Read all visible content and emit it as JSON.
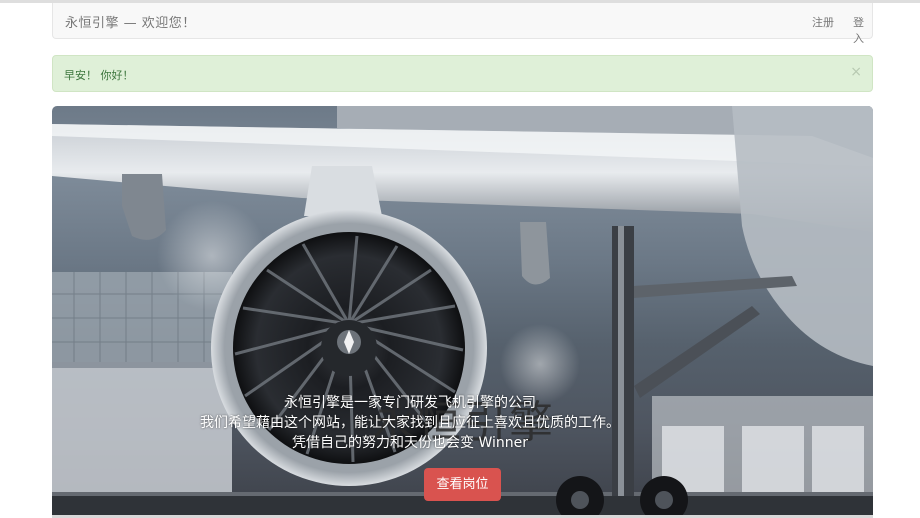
{
  "navbar": {
    "brand": "永恒引擎 — 欢迎您！",
    "register": "注册",
    "login": "登入"
  },
  "alert": {
    "message": "早安！ 你好！",
    "close": "×"
  },
  "hero": {
    "title": "永恒引擎",
    "lines": [
      "永恒引擎是一家专门研发飞机引擎的公司",
      "我们希望藉由这个网站，能让大家找到且应征上喜欢且优质的工作。",
      "凭借自己的努力和天份也会变 Winner"
    ],
    "button": "查看岗位"
  },
  "colors": {
    "accent": "#d9534f",
    "alert_bg": "#dff0d8",
    "alert_text": "#3c763d",
    "navbar_bg": "#f8f8f8"
  }
}
